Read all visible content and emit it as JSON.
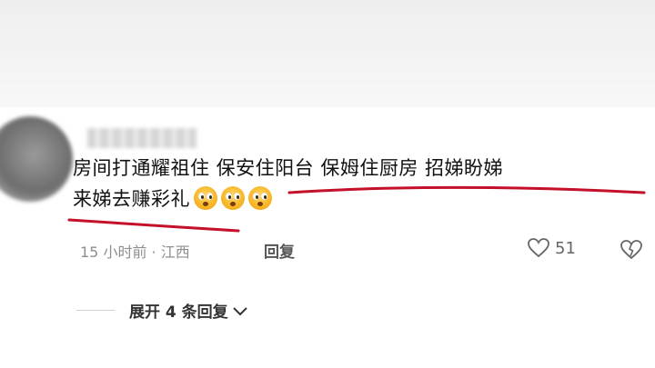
{
  "comment": {
    "text_line1": "房间打通耀祖住  保安住阳台 保姆住厨房 招娣盼娣",
    "text_line2": "来娣去赚彩礼",
    "emojis": [
      "grinning-face-icon",
      "grinning-face-icon",
      "grinning-face-icon"
    ],
    "meta": "15 小时前 · 江西",
    "reply_label": "回复",
    "like_count": "51",
    "expand_label": "展开 4 条回复"
  },
  "colors": {
    "annotation_red": "#c4102a",
    "text": "#111111",
    "meta": "#8e8e8e"
  }
}
